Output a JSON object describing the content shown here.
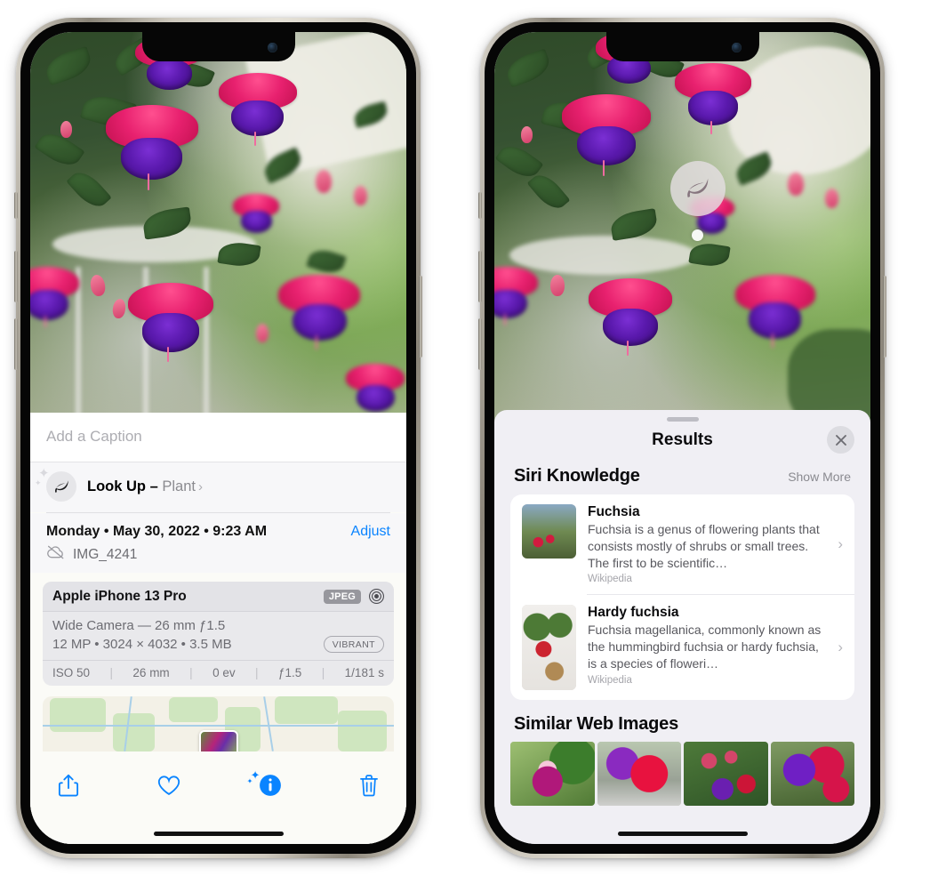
{
  "left_phone": {
    "name": "photos-info-screen",
    "caption": {
      "placeholder": "Add a Caption"
    },
    "lookup": {
      "icon": "leaf-icon",
      "label": "Look Up",
      "dash": " – ",
      "subject": "Plant",
      "chevron": "›"
    },
    "meta": {
      "date": "Monday • May 30, 2022 • 9:23 AM",
      "adjust_label": "Adjust",
      "cloud_icon": "cloud-slash-icon",
      "filename": "IMG_4241"
    },
    "camera_card": {
      "device": "Apple iPhone 13 Pro",
      "format_tag": "JPEG",
      "aperture_icon": "aperture-icon",
      "lens_line": "Wide Camera — 26 mm ƒ1.5",
      "specs_line": "12 MP • 3024 × 4032 • 3.5 MB",
      "style_tag": "VIBRANT",
      "exif": [
        "ISO 50",
        "26 mm",
        "0 ev",
        "ƒ1.5",
        "1/181 s"
      ]
    },
    "toolbar": [
      {
        "name": "share-button",
        "icon": "share-icon"
      },
      {
        "name": "favorite-button",
        "icon": "heart-icon"
      },
      {
        "name": "info-button",
        "icon": "info-sparkle-icon"
      },
      {
        "name": "delete-button",
        "icon": "trash-icon"
      }
    ]
  },
  "right_phone": {
    "name": "visual-lookup-results-screen",
    "pin": {
      "icon": "leaf-icon"
    },
    "sheet": {
      "title": "Results",
      "close_icon": "close-icon",
      "siri_knowledge": {
        "heading": "Siri Knowledge",
        "show_more": "Show More",
        "items": [
          {
            "title": "Fuchsia",
            "description": "Fuchsia is a genus of flowering plants that consists mostly of shrubs or small trees. The first to be scientific…",
            "source": "Wikipedia",
            "chevron": "›"
          },
          {
            "title": "Hardy fuchsia",
            "description": "Fuchsia magellanica, commonly known as the hummingbird fuchsia or hardy fuchsia, is a species of floweri…",
            "source": "Wikipedia",
            "chevron": "›"
          }
        ]
      },
      "similar_web_images": {
        "heading": "Similar Web Images",
        "thumbs": [
          "web-image-1",
          "web-image-2",
          "web-image-3",
          "web-image-4"
        ]
      }
    }
  },
  "colors": {
    "accent_blue": "#0a84ff",
    "sheet_bg": "#f0eff4",
    "card_bg": "#ffffff",
    "muted_text": "#8a8a90"
  }
}
